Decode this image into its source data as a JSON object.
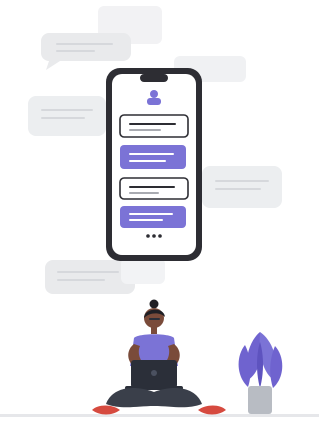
{
  "illustration": {
    "colors": {
      "background": "#ffffff",
      "bubble_gray": "#e9eaec",
      "bubble_gray_dark": "#dfe1e5",
      "accent_purple": "#7b73d6",
      "phone_frame": "#2d2d33",
      "phone_screen": "#ffffff",
      "line_gray": "#a9abb1",
      "floor": "#e6e7ea",
      "person_skin": "#7a4b3a",
      "person_hair": "#1f1f24",
      "shirt": "#7b73d6",
      "pants": "#3a3f4a",
      "shoe": "#d64a3f",
      "laptop": "#2b2f39",
      "pot": "#b8bcc3",
      "leaf": "#6f63cf"
    },
    "icons": {
      "profile": "user-icon",
      "typing": "typing-dots-icon"
    }
  }
}
